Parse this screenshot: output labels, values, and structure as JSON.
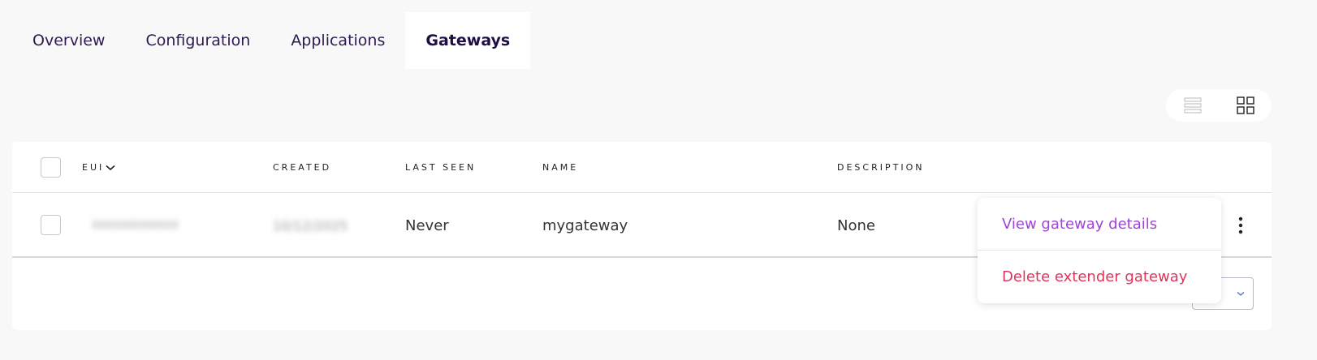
{
  "tabs": [
    {
      "label": "Overview",
      "active": false
    },
    {
      "label": "Configuration",
      "active": false
    },
    {
      "label": "Applications",
      "active": false
    },
    {
      "label": "Gateways",
      "active": true
    }
  ],
  "table": {
    "columns": {
      "eui": "EUI",
      "created": "CREATED",
      "last_seen": "LAST SEEN",
      "name": "NAME",
      "description": "DESCRIPTION"
    },
    "rows": [
      {
        "eui": "XXXXXXXXXXXX",
        "created": "10/12/2025",
        "last_seen": "Never",
        "name": "mygateway",
        "description": "None"
      }
    ]
  },
  "dropdown": {
    "view_details": "View gateway details",
    "delete": "Delete extender gateway"
  },
  "colors": {
    "view_details": "#a043d6",
    "delete": "#e0335b",
    "active_tab_bg": "#ffffff"
  }
}
